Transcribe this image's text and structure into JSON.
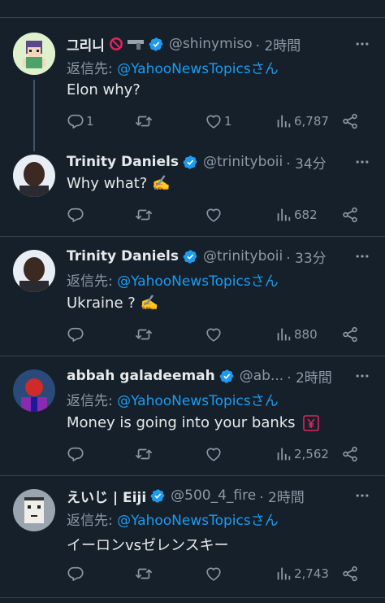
{
  "colors": {
    "background": "#15202b",
    "text": "#e7e9ea",
    "muted": "#8b98a5",
    "accent": "#1d9bf0",
    "separator": "#38444d"
  },
  "tweets": [
    {
      "name": "그리니",
      "name_emoji": [
        "no-entry-emoji",
        "pistol-emoji"
      ],
      "handle": "@shinymiso",
      "time": "· 2時間",
      "reply_label": "返信先: ",
      "reply_mention": "@YahooNewsTopicsさん",
      "text": "Elon why?",
      "replies": "1",
      "retweets": "",
      "likes": "1",
      "views": "6,787",
      "avatar": "pixel-art-avatar"
    },
    {
      "name": "Trinity Daniels",
      "handle": "@trinityboii",
      "time": "· 34分",
      "text": "Why what? ✍️",
      "replies": "",
      "retweets": "",
      "likes": "",
      "views": "682",
      "avatar": "photo-avatar"
    },
    {
      "name": "Trinity Daniels",
      "handle": "@trinityboii",
      "time": "· 33分",
      "reply_label": "返信先: ",
      "reply_mention": "@YahooNewsTopicsさん",
      "text": "Ukraine ? ✍️",
      "replies": "",
      "retweets": "",
      "likes": "",
      "views": "880",
      "avatar": "photo-avatar"
    },
    {
      "name": "abbah galadeemah",
      "handle": "@ab...",
      "time": "· 2時間",
      "reply_label": "返信先: ",
      "reply_mention": "@YahooNewsTopicsさん",
      "text": "Money is going into your banks",
      "text_emoji": "yen-emoji",
      "replies": "",
      "retweets": "",
      "likes": "",
      "views": "2,562",
      "avatar": "photo-avatar"
    },
    {
      "name": "えいじ | Eiji",
      "handle": "@500_4_fire",
      "time": "· 2時間",
      "reply_label": "返信先: ",
      "reply_mention": "@YahooNewsTopicsさん",
      "text": "イーロンvsゼレンスキー",
      "replies": "",
      "retweets": "",
      "likes": "",
      "views": "2,743",
      "avatar": "pixel-punk-avatar"
    }
  ]
}
